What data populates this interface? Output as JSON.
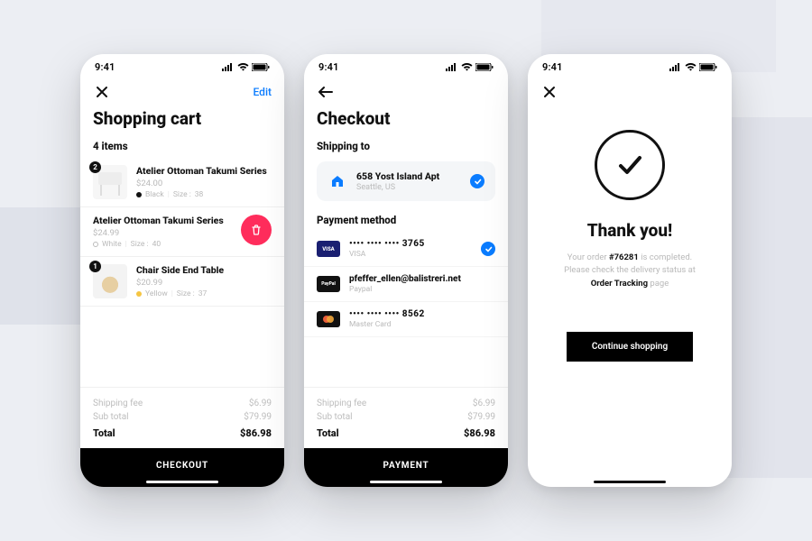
{
  "status": {
    "time": "9:41"
  },
  "cart": {
    "title": "Shopping cart",
    "edit_label": "Edit",
    "count_label": "4 items",
    "items": [
      {
        "name": "Atelier Ottoman Takumi Series",
        "price": "$24.00",
        "color": "Black",
        "size_label": "Size :",
        "size": "38",
        "qty": "2"
      },
      {
        "name": "Atelier Ottoman Takumi Series",
        "price": "$24.99",
        "color": "White",
        "size_label": "Size :",
        "size": "40"
      },
      {
        "name": "Chair Side End Table",
        "price": "$20.99",
        "color": "Yellow",
        "size_label": "Size :",
        "size": "37",
        "qty": "1"
      }
    ],
    "totals": {
      "shipping_label": "Shipping fee",
      "shipping_value": "$6.99",
      "subtotal_label": "Sub total",
      "subtotal_value": "$79.99",
      "total_label": "Total",
      "total_value": "$86.98"
    },
    "cta": "CHECKOUT"
  },
  "checkout": {
    "title": "Checkout",
    "shipping_label": "Shipping to",
    "address": {
      "line1": "658 Yost Island Apt",
      "line2": "Seattle, US"
    },
    "payment_label": "Payment method",
    "methods": [
      {
        "display": "•••• •••• •••• 3765",
        "brand": "VISA",
        "selected": true
      },
      {
        "display": "pfeffer_ellen@balistreri.net",
        "brand": "Paypal",
        "selected": false
      },
      {
        "display": "•••• •••• •••• 8562",
        "brand": "Master Card",
        "selected": false
      }
    ],
    "totals": {
      "shipping_label": "Shipping fee",
      "shipping_value": "$6.99",
      "subtotal_label": "Sub total",
      "subtotal_value": "$79.99",
      "total_label": "Total",
      "total_value": "$86.98"
    },
    "cta": "PAYMENT"
  },
  "thanks": {
    "title": "Thank you!",
    "msg_pre": "Your order ",
    "order_num": "#76281",
    "msg_mid": " is completed.",
    "msg_line2a": "Please check the delivery status at",
    "track_link": "Order Tracking",
    "msg_line2b": " page",
    "continue": "Continue shopping"
  }
}
